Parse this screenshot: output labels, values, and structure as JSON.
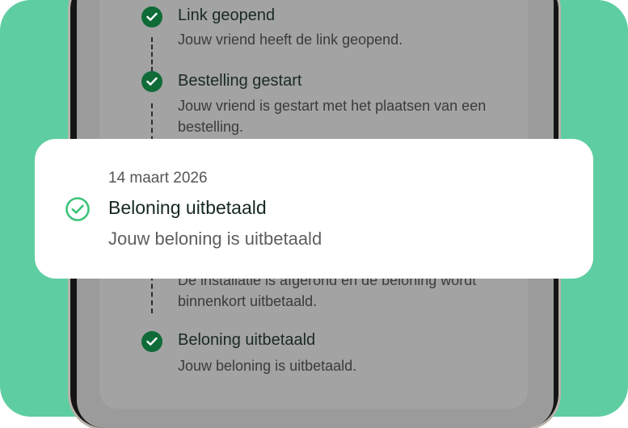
{
  "timeline": {
    "items": [
      {
        "title": "Link geopend",
        "description": "Jouw vriend heeft de link geopend."
      },
      {
        "title": "Bestelling gestart",
        "description": "Jouw vriend is gestart met het plaatsen van een bestelling."
      },
      {
        "title": "",
        "description": "De installatie is afgerond en de beloning wordt binnenkort uitbetaald."
      },
      {
        "title": "Beloning uitbetaald",
        "description": "Jouw beloning is uitbetaald."
      }
    ]
  },
  "notification": {
    "date": "14 maart 2026",
    "title": "Beloning uitbetaald",
    "description": "Jouw beloning is uitbetaald",
    "icon": "check-circle-icon"
  },
  "colors": {
    "background": "#5ecda2",
    "check_fill": "#0f6b38",
    "popup_check": "#3cc47a"
  }
}
